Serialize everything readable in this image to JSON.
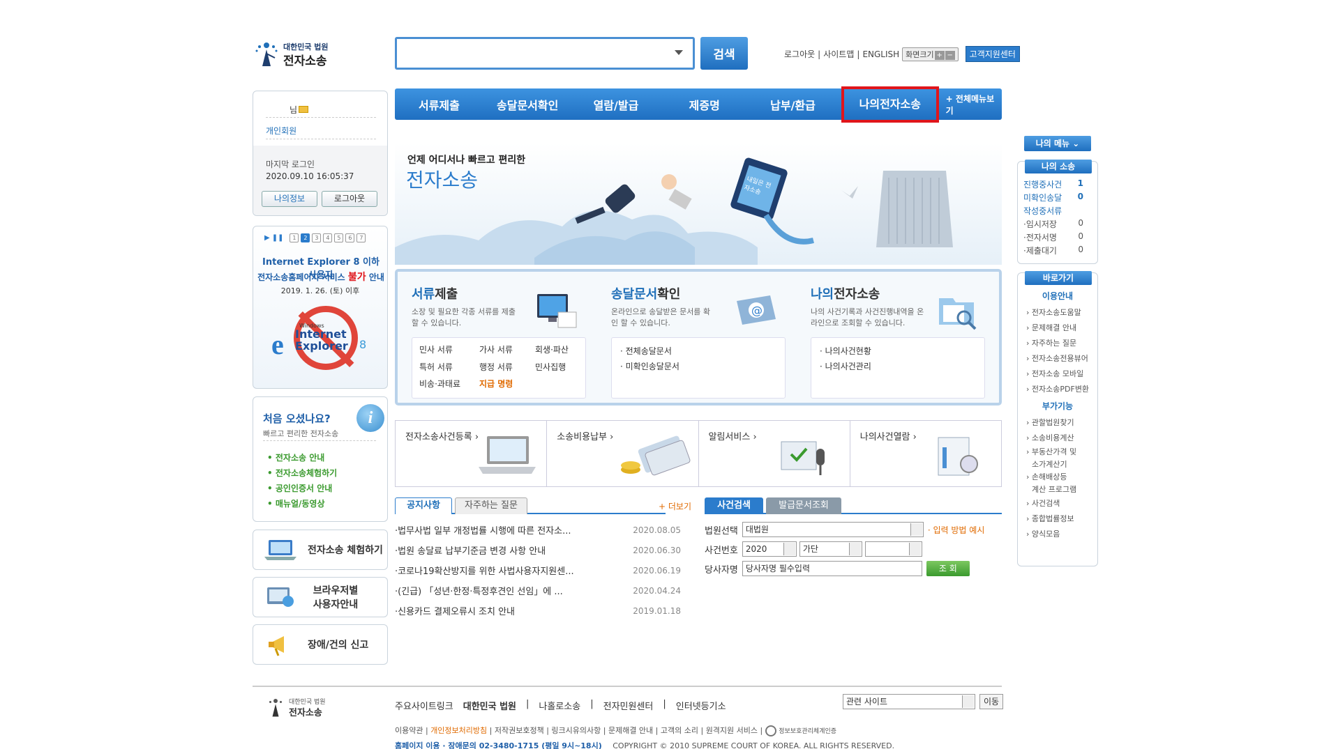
{
  "header": {
    "logo_sub": "대한민국 법원",
    "logo_main": "전자소송",
    "search_button": "검색",
    "util": {
      "logout": "로그아웃",
      "sitemap": "사이트맵",
      "english": "ENGLISH",
      "screen_size": "화면크기",
      "customer_center": "고객지원센터"
    }
  },
  "gnb": {
    "items": [
      "서류제출",
      "송달문서확인",
      "열람/발급",
      "제증명",
      "납부/환급",
      "나의전자소송"
    ],
    "all_menu": "+ 전체메뉴보기"
  },
  "user": {
    "suffix": "님",
    "member_type": "개인회원",
    "last_login_label": "마지막 로그인",
    "last_login_time": "2020.09.10 16:05:37",
    "my_info": "나의정보",
    "logout": "로그아웃"
  },
  "ie_notice": {
    "pager": [
      "1",
      "2",
      "3",
      "4",
      "5",
      "6",
      "7"
    ],
    "line1": "Internet Explorer 8 이하 사용자",
    "line2_a": "전자소송홈페이지 서비스 ",
    "line2_b": "불가",
    "line2_c": " 안내",
    "date": "2019. 1. 26. (토) 이후",
    "windows": "Windows",
    "ie_text": "Internet Explorer",
    "ie_ver": "8"
  },
  "first_visit": {
    "title": "처음 오셨나요?",
    "subtitle": "빠르고 편리한 전자소송",
    "links": [
      "전자소송 안내",
      "전자소송체험하기",
      "공인인증서 안내",
      "매뉴얼/동영상"
    ]
  },
  "side_buttons": [
    "전자소송 체험하기",
    "브라우저별 사용자안내",
    "장애/건의 신고"
  ],
  "banner": {
    "tagline": "언제 어디서나 빠르고 편리한",
    "title": "전자소송",
    "sign": "내일은 전자소송"
  },
  "services": [
    {
      "title_a": "서류",
      "title_b": "제출",
      "desc": "소장 및 필요한 각종 서류를 제출할 수 있습니다.",
      "items": [
        "민사 서류",
        "가사 서류",
        "회생·파산",
        "특허 서류",
        "행정 서류",
        "민사집행",
        "비송·과태료",
        "지급 명령"
      ]
    },
    {
      "title_a": "송달문서",
      "title_b": "확인",
      "desc": "온라인으로 송달받은 문서를 확인 할 수 있습니다.",
      "items": [
        "전체송달문서",
        "미확인송달문서"
      ]
    },
    {
      "title_a": "나의",
      "title_b": "전자소송",
      "desc": "나의 사건기록과 사건진행내역을 온라인으로 조회할 수 있습니다.",
      "items": [
        "나의사건현황",
        "나의사건관리"
      ]
    }
  ],
  "quick": [
    "전자소송사건등록",
    "소송비용납부",
    "알림서비스",
    "나의사건열람"
  ],
  "notice": {
    "tabs": [
      "공지사항",
      "자주하는 질문"
    ],
    "more": "+ 더보기",
    "rows": [
      {
        "title": "법무사법 일부 개정법률 시행에 따른 전자소...",
        "date": "2020.08.05"
      },
      {
        "title": "법원 송달료 납부기준금 변경 사항 안내",
        "date": "2020.06.30"
      },
      {
        "title": "코로나19확산방지를 위한 사법사용자지원센...",
        "date": "2020.06.19"
      },
      {
        "title": "(긴급) 「성년·한정·특정후견인 선임」에 ...",
        "date": "2020.04.24"
      },
      {
        "title": "신용카드 결제오류시 조치 안내",
        "date": "2019.01.18"
      }
    ]
  },
  "case_search": {
    "tabs": [
      "사건검색",
      "발급문서조회"
    ],
    "court_label": "법원선택",
    "court_value": "대법원",
    "input_example": "입력 방법 예시",
    "case_no_label": "사건번호",
    "year": "2020",
    "case_type": "가단",
    "party_label": "당사자명",
    "party_placeholder": "당사자명 필수입력",
    "submit": "조 회"
  },
  "right": {
    "my_menu": "나의 메뉴",
    "my_case_title": "나의 소송",
    "my_case": [
      {
        "label": "진행중사건",
        "n": "1"
      },
      {
        "label": "미확인송달",
        "n": "0"
      },
      {
        "label": "작성중서류",
        "n": ""
      },
      {
        "label": "·임시저장",
        "n": "0"
      },
      {
        "label": "·전자서명",
        "n": "0"
      },
      {
        "label": "·제출대기",
        "n": "0"
      }
    ],
    "quick_title": "바로가기",
    "guide_title": "이용안내",
    "guide": [
      "전자소송도움말",
      "문제해결 안내",
      "자주하는 질문",
      "전자소송전용뷰어",
      "전자소송 모바일",
      "전자소송PDF변환"
    ],
    "extra_title": "부가기능",
    "extra": [
      "관할법원찾기",
      "소송비용계산",
      "부동산가격 및",
      "소가계산기",
      "손해배상등",
      "계산 프로그램",
      "사건검색",
      "종합법률정보",
      "양식모음"
    ]
  },
  "footer": {
    "links": [
      "주요사이트링크",
      "대한민국 법원",
      "나홀로소송",
      "전자민원센터",
      "인터넷등기소"
    ],
    "related": "관련 사이트",
    "go": "이동",
    "sub": [
      "이용약관",
      "개인정보처리방침",
      "저작권보호정책",
      "링크시유의사항",
      "문제해결 안내",
      "고객의 소리",
      "원격지원 서비스"
    ],
    "cert": "정보보호관리체계인증",
    "phone": "홈페이지 이용 · 장애문의 02-3480-1715 (평일 9시~18시)",
    "copyright": "COPYRIGHT © 2010 SUPREME COURT OF KOREA. ALL RIGHTS RESERVED."
  },
  "colors": {
    "primary": "#1f6fc1",
    "highlight": "#e0151b",
    "accent_orange": "#e06a00",
    "notice_green": "#3a9a2e"
  }
}
